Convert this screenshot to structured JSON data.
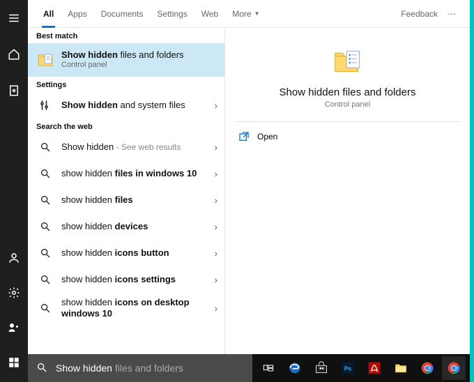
{
  "tabs": {
    "items": [
      "All",
      "Apps",
      "Documents",
      "Settings",
      "Web",
      "More"
    ],
    "feedback": "Feedback"
  },
  "sections": {
    "best_match": "Best match",
    "settings": "Settings",
    "web": "Search the web"
  },
  "best": {
    "prefix": "Show hidden",
    "suffix": " files and folders",
    "sub": "Control panel"
  },
  "settings_item": {
    "prefix": "Show hidden",
    "suffix": " and system files"
  },
  "web_items": [
    {
      "plain": "Show hidden",
      "bold": "",
      "hint": " - See web results"
    },
    {
      "plain": "show hidden ",
      "bold": "files in windows 10",
      "hint": ""
    },
    {
      "plain": "show hidden ",
      "bold": "files",
      "hint": ""
    },
    {
      "plain": "show hidden ",
      "bold": "devices",
      "hint": ""
    },
    {
      "plain": "show hidden ",
      "bold": "icons button",
      "hint": ""
    },
    {
      "plain": "show hidden ",
      "bold": "icons settings",
      "hint": ""
    },
    {
      "plain": "show hidden ",
      "bold": "icons on desktop windows 10",
      "hint": ""
    }
  ],
  "preview": {
    "title": "Show hidden files and folders",
    "sub": "Control panel",
    "open": "Open"
  },
  "search": {
    "typed": "Show hidden",
    "ghost": " files and folders"
  },
  "colors": {
    "accent": "#0078d4",
    "selected": "#cce8f6",
    "teal": "#00c2c2"
  }
}
